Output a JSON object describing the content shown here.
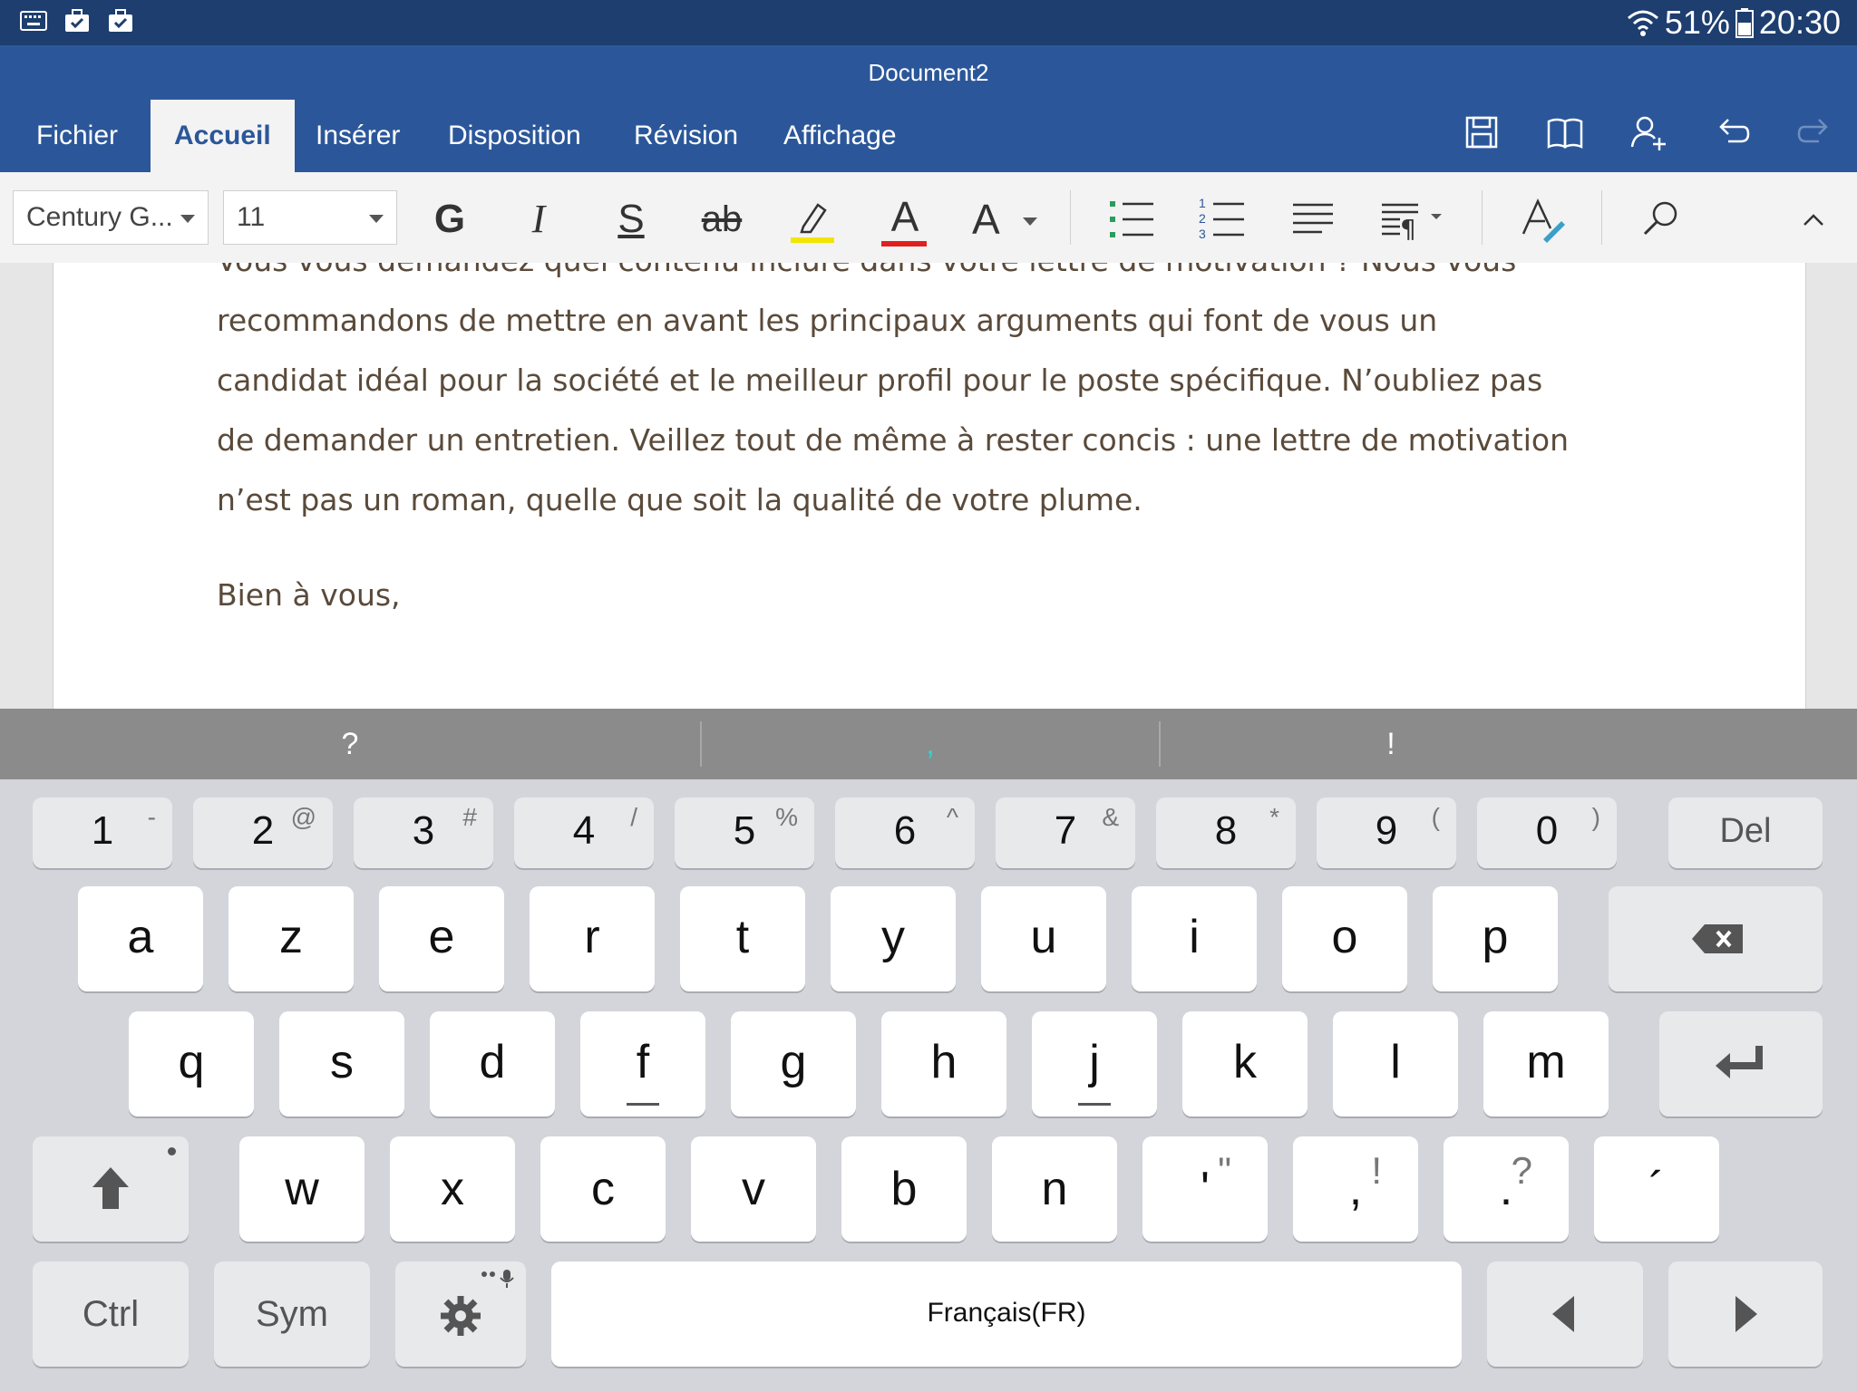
{
  "status_bar": {
    "left_icons": [
      "keyboard-icon",
      "briefcase-check-icon",
      "briefcase-check-icon"
    ],
    "battery_text": "51%",
    "time": "20:30"
  },
  "app": {
    "document_title": "Document2",
    "tabs": [
      {
        "label": "Fichier",
        "active": false
      },
      {
        "label": "Accueil",
        "active": true
      },
      {
        "label": "Insérer",
        "active": false
      },
      {
        "label": "Disposition",
        "active": false
      },
      {
        "label": "Révision",
        "active": false
      },
      {
        "label": "Affichage",
        "active": false
      }
    ],
    "ribbon_actions": [
      "save-icon",
      "read-mode-icon",
      "share-icon",
      "undo-icon",
      "redo-icon"
    ]
  },
  "toolbar": {
    "font_name": "Century G...",
    "font_size": "11",
    "bold_label": "G",
    "italic_label": "I",
    "underline_label": "S",
    "strike_label": "ab",
    "font_color_label": "A",
    "font_size_label": "A",
    "colors": {
      "highlight": "#f2e600",
      "font_color": "#e0201f",
      "accent": "#2b579a"
    }
  },
  "document": {
    "lines": [
      "Vous vous demandez quel contenu inclure dans votre lettre de motivation ? Nous vous",
      "recommandons de mettre en avant les principaux arguments qui font de vous un",
      "candidat idéal pour la société et le meilleur profil pour le poste spécifique. N’oubliez pas",
      "de demander un entretien. Veillez tout de même à rester concis : une lettre de motivation",
      "n’est pas un roman, quelle que soit la qualité de votre plume."
    ],
    "closing": "Bien à vous,"
  },
  "suggestions": [
    "?",
    ",",
    "!"
  ],
  "keyboard": {
    "number_row": [
      {
        "main": "1",
        "sub": "-"
      },
      {
        "main": "2",
        "sub": "@"
      },
      {
        "main": "3",
        "sub": "#"
      },
      {
        "main": "4",
        "sub": "/"
      },
      {
        "main": "5",
        "sub": "%"
      },
      {
        "main": "6",
        "sub": "^"
      },
      {
        "main": "7",
        "sub": "&"
      },
      {
        "main": "8",
        "sub": "*"
      },
      {
        "main": "9",
        "sub": "("
      },
      {
        "main": "0",
        "sub": ")"
      }
    ],
    "del_label": "Del",
    "row1": [
      "a",
      "z",
      "e",
      "r",
      "t",
      "y",
      "u",
      "i",
      "o",
      "p"
    ],
    "row2": [
      "q",
      "s",
      "d",
      "f",
      "g",
      "h",
      "j",
      "k",
      "l",
      "m"
    ],
    "row3": [
      {
        "main": "w",
        "sub": ""
      },
      {
        "main": "x",
        "sub": ""
      },
      {
        "main": "c",
        "sub": ""
      },
      {
        "main": "v",
        "sub": ""
      },
      {
        "main": "b",
        "sub": ""
      },
      {
        "main": "n",
        "sub": ""
      },
      {
        "main": "'",
        "sub": "\""
      },
      {
        "main": ",",
        "sub": "!"
      },
      {
        "main": ".",
        "sub": "?"
      },
      {
        "main": "´",
        "sub": ""
      }
    ],
    "ctrl_label": "Ctrl",
    "sym_label": "Sym",
    "space_label": "Français(FR)"
  }
}
